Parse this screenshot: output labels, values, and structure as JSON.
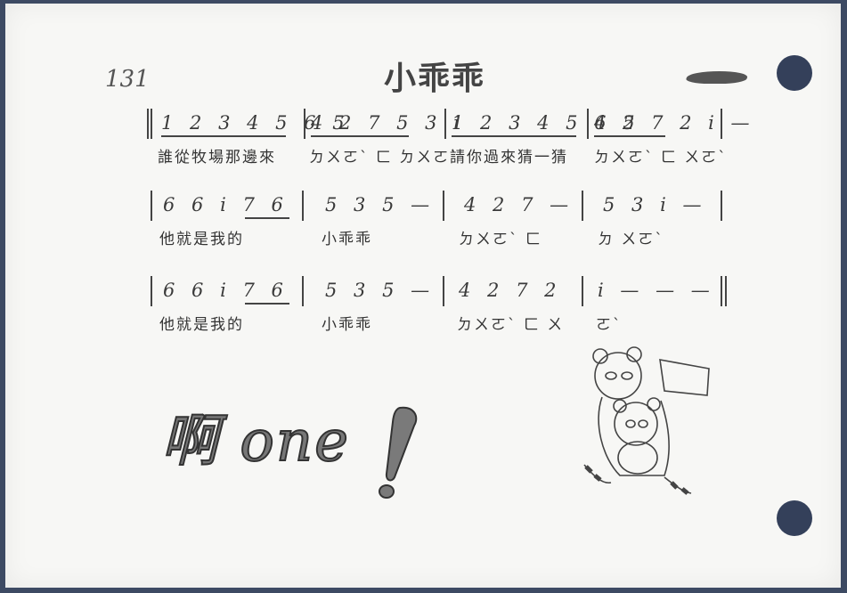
{
  "page_number": "131",
  "title": "小乖乖",
  "lines": [
    {
      "measures": [
        {
          "notes": "1 2 3 4 5 6 5"
        },
        {
          "notes": "4 2 7 5 3 i"
        },
        {
          "notes": "1 2 3 4 5 6 5"
        },
        {
          "notes": "4 2 7 2 i —"
        }
      ],
      "lyrics": [
        "誰從牧場那邊來",
        "ㄉㄨㄛˋ ㄈ ㄉㄨㄛˋ",
        "請你過來猜一猜",
        "ㄉㄨㄛˋ ㄈ ㄨㄛˋ"
      ]
    },
    {
      "measures": [
        {
          "notes": "6 6 i 7 6"
        },
        {
          "notes": "5 3 5 —"
        },
        {
          "notes": "4 2 7 —"
        },
        {
          "notes": "5 3 i —"
        }
      ],
      "lyrics": [
        "他就是我的",
        "小乖乖",
        "ㄉㄨㄛˋ ㄈ",
        "ㄉ ㄨㄛˋ"
      ]
    },
    {
      "measures": [
        {
          "notes": "6 6 i 7 6"
        },
        {
          "notes": "5 3 5 —"
        },
        {
          "notes": "4 2 7 2"
        },
        {
          "notes": "i — — —"
        }
      ],
      "lyrics": [
        "他就是我的",
        "小乖乖",
        "ㄉㄨㄛˋ ㄈ ㄨ",
        "ㄛˋ"
      ]
    }
  ],
  "big_text": "啊 one",
  "colors": {
    "paper": "#f7f7f5",
    "ink": "#3a3a3a",
    "background": "#3d4a63"
  }
}
